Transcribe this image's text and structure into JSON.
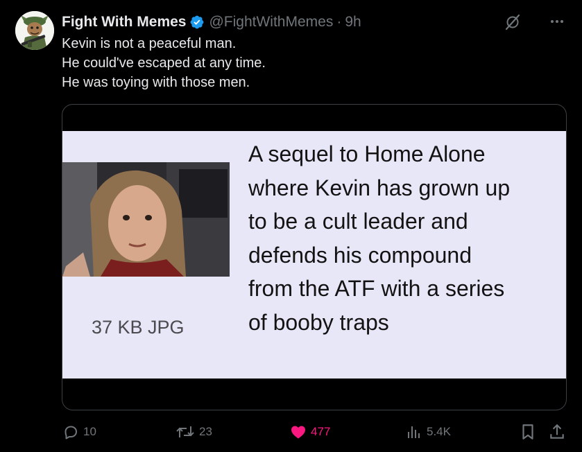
{
  "author": {
    "display_name": "Fight With Memes",
    "handle": "@FightWithMemes",
    "separator": "·",
    "time": "9h",
    "verified": true,
    "avatar_icon": "soldier-cartoon-avatar"
  },
  "tweet": {
    "lines": [
      "Kevin is not a peaceful man.",
      "He could've escaped at any time.",
      "He was toying with those men."
    ]
  },
  "media": {
    "file_label": "37 KB JPG",
    "caption_lines": [
      "A sequel to Home Alone",
      "where Kevin has grown up",
      "to be a cult leader and",
      "defends his compound",
      "from the ATF with a series",
      "of booby traps"
    ]
  },
  "actions": {
    "replies": "10",
    "reposts": "23",
    "likes": "477",
    "views": "5.4K"
  },
  "colors": {
    "background": "#000000",
    "text_primary": "#e7e9ea",
    "text_secondary": "#71767b",
    "verified_blue": "#1d9bf0",
    "like_pink": "#f91880",
    "meme_background": "#e8e7f8"
  }
}
